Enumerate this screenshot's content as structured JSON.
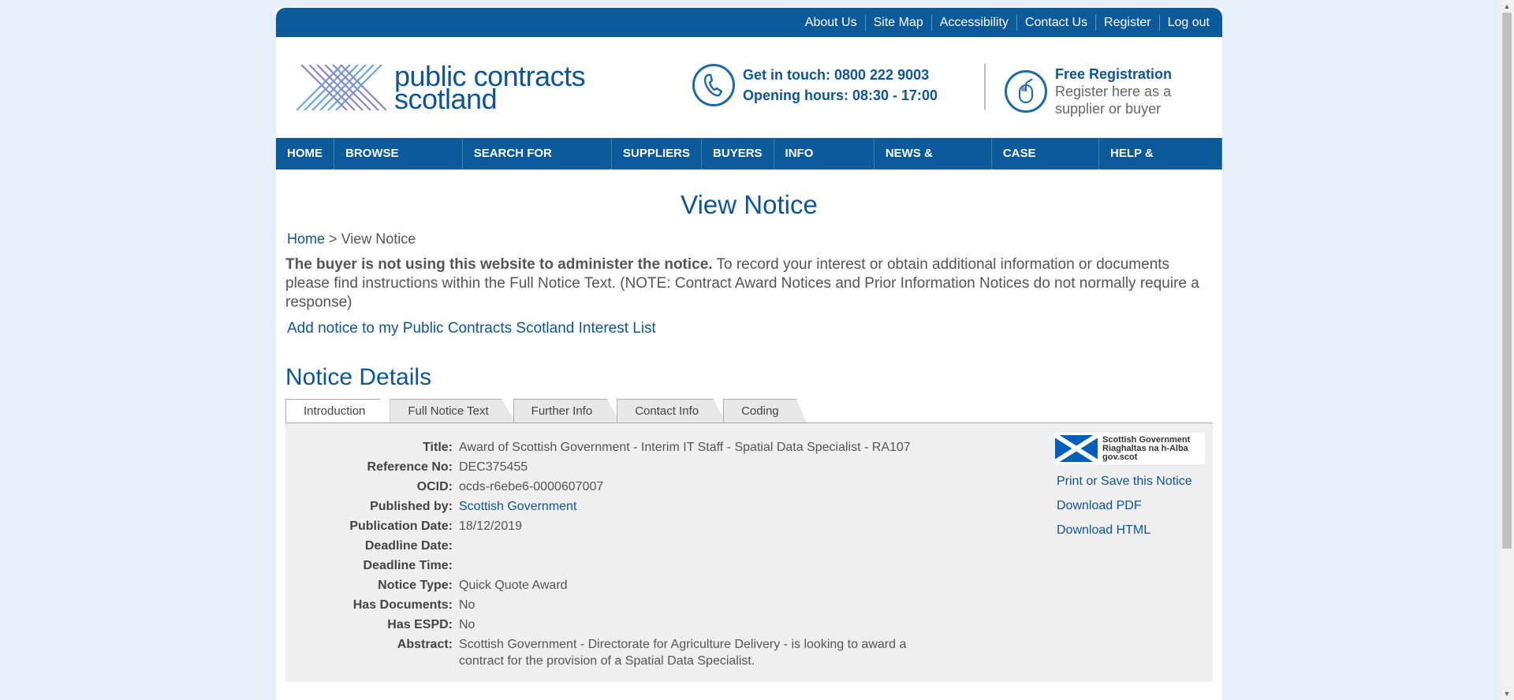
{
  "topbar": {
    "links": [
      "About Us",
      "Site Map",
      "Accessibility",
      "Contact Us",
      "Register",
      "Log out"
    ]
  },
  "header": {
    "logo_line1": "public contracts",
    "logo_line2": "scotland",
    "contact_line1": "Get in touch: 0800 222 9003",
    "contact_line2": "Opening hours: 08:30 - 17:00",
    "reg_title": "Free Registration",
    "reg_line1": "Register here as a",
    "reg_line2": "supplier or buyer"
  },
  "nav": {
    "items": [
      "HOME",
      "BROWSE NOTICES",
      "SEARCH FOR BUYERS",
      "SUPPLIERS",
      "BUYERS",
      "INFO CENTRE",
      "NEWS & EVENTS",
      "CASE STUDIES",
      "HELP & SUPPORT"
    ]
  },
  "page": {
    "title": "View Notice",
    "breadcrumb_home": "Home",
    "breadcrumb_sep": ">",
    "breadcrumb_current": "View Notice",
    "notice_bold": "The buyer is not using this website to administer the notice.",
    "notice_text": " To record your interest or obtain additional information or documents please find instructions within the Full Notice Text. (NOTE: Contract Award Notices and Prior Information Notices do not normally require a response)",
    "add_link": "Add notice to my Public Contracts Scotland Interest List",
    "details_heading": "Notice Details"
  },
  "tabs": [
    "Introduction",
    "Full Notice Text",
    "Further Info",
    "Contact Info",
    "Coding"
  ],
  "fields": [
    {
      "label": "Title:",
      "value": "Award of Scottish Government - Interim IT Staff - Spatial Data Specialist - RA107"
    },
    {
      "label": "Reference No:",
      "value": "DEC375455"
    },
    {
      "label": "OCID:",
      "value": "ocds-r6ebe6-0000607007"
    },
    {
      "label": "Published by:",
      "value": "Scottish Government"
    },
    {
      "label": "Publication Date:",
      "value": "18/12/2019"
    },
    {
      "label": "Deadline Date:",
      "value": ""
    },
    {
      "label": "Deadline Time:",
      "value": ""
    },
    {
      "label": "Notice Type:",
      "value": "Quick Quote Award"
    },
    {
      "label": "Has Documents:",
      "value": "No"
    },
    {
      "label": "Has ESPD:",
      "value": "No"
    },
    {
      "label": "Abstract:",
      "value": "Scottish Government - Directorate for Agriculture Delivery - is looking to award a contract for the provision of a Spatial Data Specialist."
    }
  ],
  "side": {
    "gov_line1": "Scottish Government",
    "gov_line2": "Riaghaltas na h-Alba",
    "gov_line3": "gov.scot",
    "print_link": "Print or Save this Notice",
    "pdf_link": "Download PDF",
    "html_link": "Download HTML"
  }
}
